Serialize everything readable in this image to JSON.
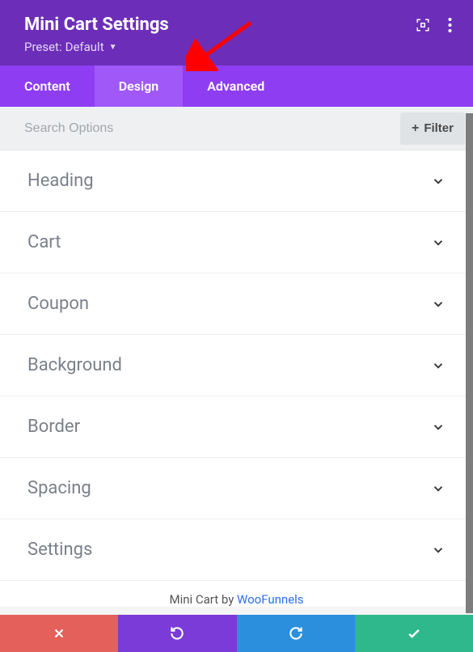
{
  "header": {
    "title": "Mini Cart Settings",
    "preset_label": "Preset:",
    "preset_value": "Default"
  },
  "tabs": {
    "content": "Content",
    "design": "Design",
    "advanced": "Advanced",
    "active": "design"
  },
  "search": {
    "placeholder": "Search Options",
    "filter_label": "Filter"
  },
  "sections": [
    {
      "label": "Heading"
    },
    {
      "label": "Cart"
    },
    {
      "label": "Coupon"
    },
    {
      "label": "Background"
    },
    {
      "label": "Border"
    },
    {
      "label": "Spacing"
    },
    {
      "label": "Settings"
    }
  ],
  "footer_credit": {
    "prefix": "Mini Cart by ",
    "link_text": "WooFunnels"
  }
}
